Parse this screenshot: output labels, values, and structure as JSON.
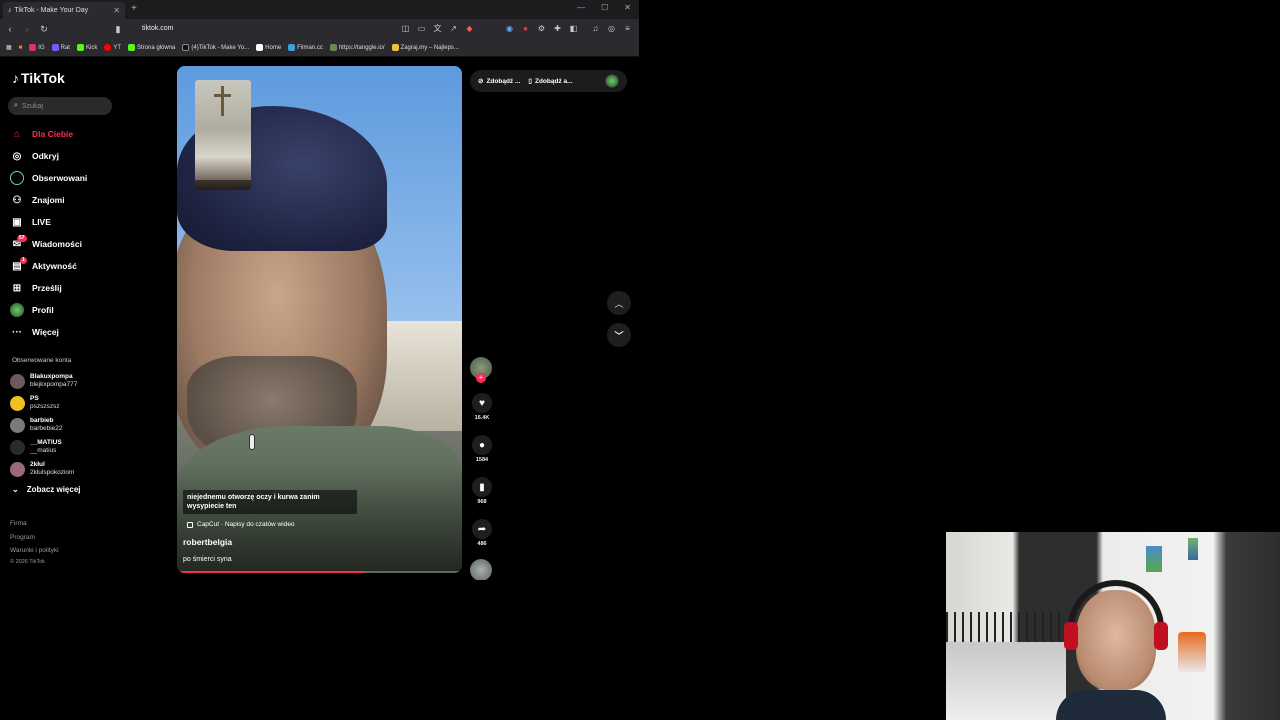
{
  "browser": {
    "tab_title": "TikTok - Make Your Day",
    "url": "tiktok.com",
    "bookmarks": [
      {
        "label": "IG",
        "color": "#e1306c"
      },
      {
        "label": "Rat",
        "color": "#7a5af8"
      },
      {
        "label": "Kick",
        "color": "#53fc18"
      },
      {
        "label": "YT",
        "color": "#ff0000"
      },
      {
        "label": "Strona główna",
        "color": "#53fc18"
      },
      {
        "label": "(4)TikTok - Make Yo...",
        "color": "#000000"
      },
      {
        "label": "Home",
        "color": "#ffffff"
      },
      {
        "label": "Filman.cc",
        "color": "#3aa0e0"
      },
      {
        "label": "https://tanggle.io/",
        "color": "#6a8a4a"
      },
      {
        "label": "Zagraj.my – Najleps...",
        "color": "#f0c040"
      }
    ]
  },
  "sidebar": {
    "logo": "TikTok",
    "search_placeholder": "Szukaj",
    "nav": [
      {
        "label": "Dla Ciebie",
        "icon": "home-icon",
        "active": true
      },
      {
        "label": "Odkryj",
        "icon": "compass-icon"
      },
      {
        "label": "Obserwowani",
        "icon": "following-icon"
      },
      {
        "label": "Znajomi",
        "icon": "friends-icon"
      },
      {
        "label": "LIVE",
        "icon": "live-icon"
      },
      {
        "label": "Wiadomości",
        "icon": "messages-icon",
        "badge": "57"
      },
      {
        "label": "Aktywność",
        "icon": "activity-icon",
        "badge": "1"
      },
      {
        "label": "Prześlij",
        "icon": "upload-icon"
      },
      {
        "label": "Profil",
        "icon": "profile-icon"
      },
      {
        "label": "Więcej",
        "icon": "more-icon"
      }
    ],
    "followed_header": "Obserwowane konta",
    "followed": [
      {
        "name": "Blakuxpompa",
        "handle": "blejkxpompa777"
      },
      {
        "name": "PS",
        "handle": "pszszszsz"
      },
      {
        "name": "barbieb",
        "handle": "barbebie22"
      },
      {
        "name": "__MATIUS",
        "handle": "__matius"
      },
      {
        "name": "2kłul",
        "handle": "2klulspokoziom"
      }
    ],
    "see_more": "Zobacz więcej",
    "footer": [
      "Firma",
      "Program",
      "Warunki i polityki"
    ],
    "copyright": "© 2026 TikTok"
  },
  "video": {
    "caption": "niejednemu otworzę oczy i kurwa zanim wysypiecie ten",
    "capcut": "CapCut · Napisy do czatów wideo",
    "author": "robertbelgia",
    "description": "po śmierci syna",
    "progress": 0.66
  },
  "actions": {
    "likes": "16.4K",
    "comments": "1584",
    "saves": "968",
    "shares": "486"
  },
  "top_pills": [
    "Zdobądź ...",
    "Zdobądź a..."
  ]
}
